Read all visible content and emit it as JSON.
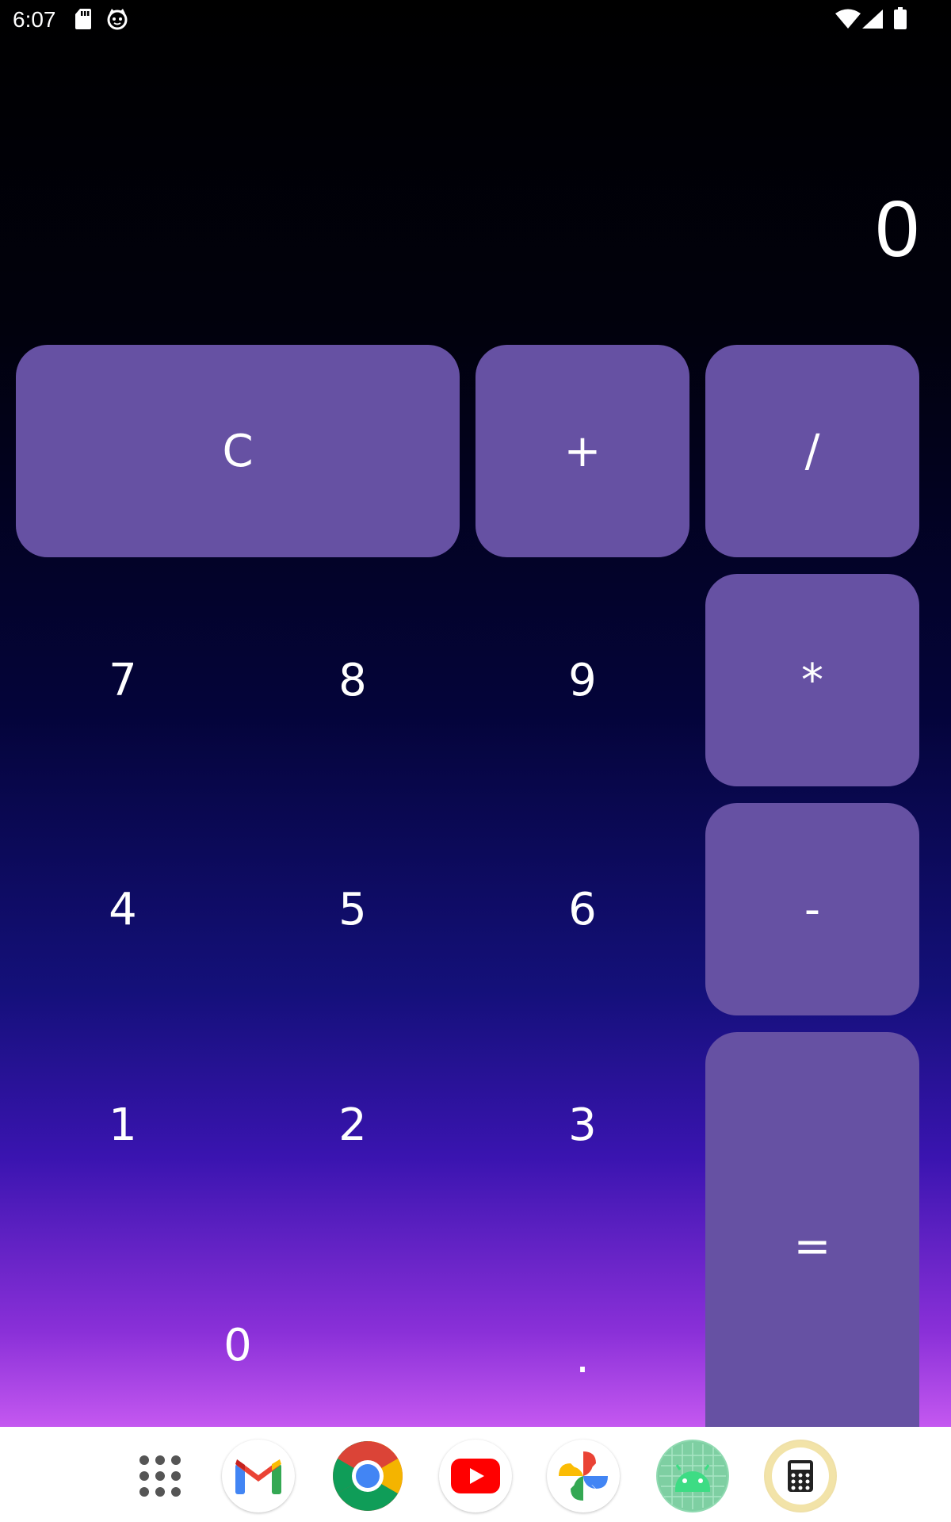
{
  "status_bar": {
    "time": "6:07",
    "left_icons": [
      "sd-card-icon",
      "cat-face-icon"
    ],
    "right_icons": [
      "wifi-icon",
      "cellular-signal-icon",
      "battery-icon"
    ]
  },
  "display": {
    "value": "0"
  },
  "keys": {
    "clear": "C",
    "plus": "+",
    "divide": "/",
    "multiply": "*",
    "minus": "-",
    "equals": "=",
    "dot": ".",
    "digits": {
      "d0": "0",
      "d1": "1",
      "d2": "2",
      "d3": "3",
      "d4": "4",
      "d5": "5",
      "d6": "6",
      "d7": "7",
      "d8": "8",
      "d9": "9"
    }
  },
  "dock": {
    "apps": [
      "app-drawer-icon",
      "gmail-icon",
      "chrome-icon",
      "youtube-icon",
      "google-photos-icon",
      "android-icon",
      "calculator-app-icon"
    ]
  },
  "colors": {
    "key_background": "#6651a3",
    "gradient_top": "#000000",
    "gradient_bottom": "#c458f0",
    "dock_background": "#ffffff"
  }
}
